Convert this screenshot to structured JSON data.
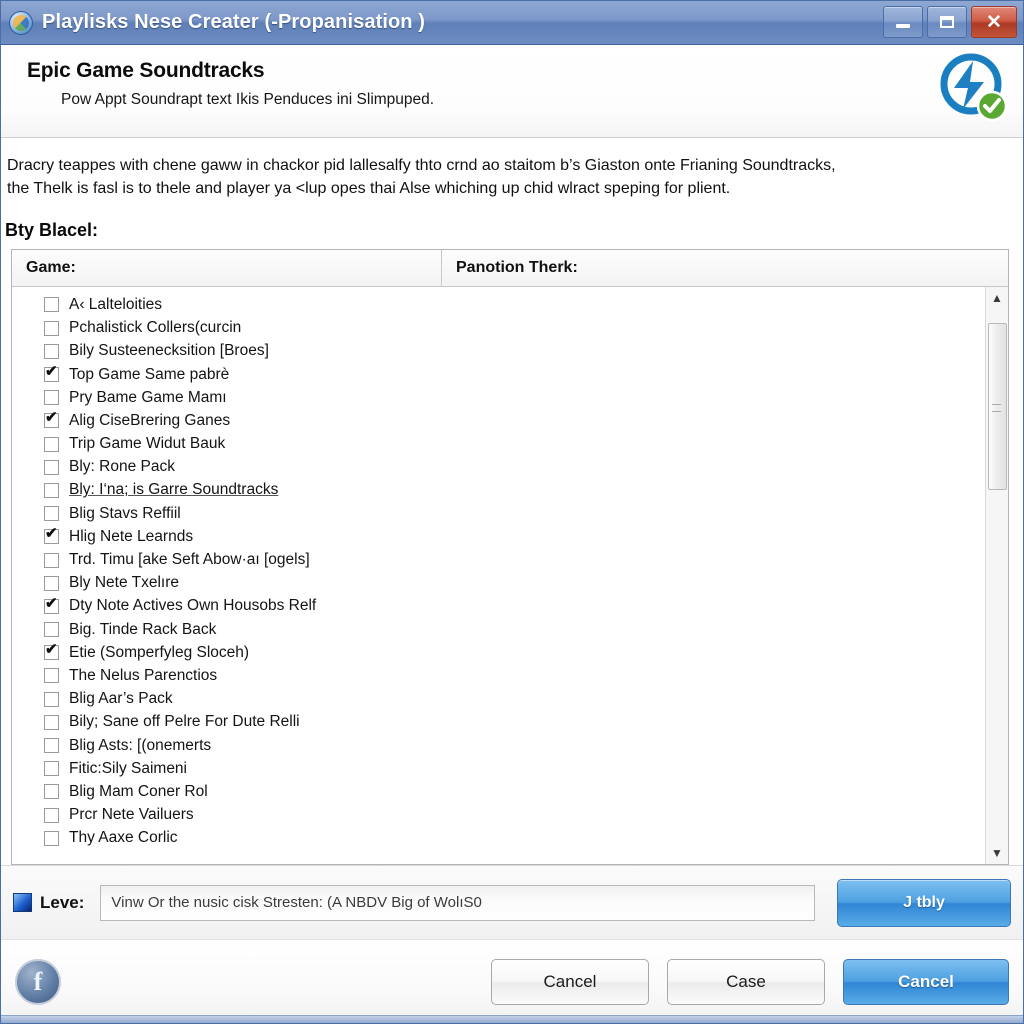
{
  "window": {
    "title": "Playlisks Nese Creater (-Propanisation )",
    "icon": "app-globe-icon",
    "controls": {
      "minimize": "minimize-icon",
      "maximize": "maximize-icon",
      "close": "close-icon"
    },
    "titlebar_color": "#6d8cc2"
  },
  "banner": {
    "heading": "Epic Game Soundtracks",
    "subheading": "Pow Appt Soundrapt text Ikis Penduces ini Slimpuped.",
    "logo": "lightning-bolt-verified-icon",
    "logo_color": "#1a7fc1",
    "badge_color": "#5aa832"
  },
  "description": {
    "line1": "Dracry teappes with chene gaww in chackor pid lallesalfy thto crnd ao staitom b’s Giaston onte Frianing Soundtracks,",
    "line2": "the Thelk is fasl is to thele and player ya <lup opes thai Alse whiching up chid wlract speping for plient."
  },
  "section": {
    "label": "Bty Blacel:"
  },
  "table": {
    "headers": {
      "col1": "Game:",
      "col2": "Panotion Therk:"
    },
    "rows": [
      {
        "label": "A‹ Lalteloities",
        "checked": false,
        "underlined": false
      },
      {
        "label": "Pchalistick Collers(curcin",
        "checked": false,
        "underlined": false
      },
      {
        "label": "Bily Susteenecksition [Broes]",
        "checked": false,
        "underlined": false
      },
      {
        "label": "Top Game Same pabrè",
        "checked": true,
        "underlined": false
      },
      {
        "label": "Pry Bame Game Mamı",
        "checked": false,
        "underlined": false
      },
      {
        "label": "Alig CiseBrering Ganes",
        "checked": true,
        "underlined": false
      },
      {
        "label": "Trip Game Widut Bauk",
        "checked": false,
        "underlined": false
      },
      {
        "label": "Bly: Rone Pack",
        "checked": false,
        "underlined": false
      },
      {
        "label": "Bly: I‘na; is Garre Soundtracks",
        "checked": false,
        "underlined": true
      },
      {
        "label": "Blig Stavs Reffiil",
        "checked": false,
        "underlined": false
      },
      {
        "label": "Hlig Nete Learnds",
        "checked": true,
        "underlined": false
      },
      {
        "label": "Trd. Timu [ake Seft Abow·aı [ogels]",
        "checked": false,
        "underlined": false
      },
      {
        "label": "Bly Nete Txelıre",
        "checked": false,
        "underlined": false
      },
      {
        "label": "Dty Note Actives Own Housobs Relf",
        "checked": true,
        "underlined": false
      },
      {
        "label": "Big. Tinde Rack Back",
        "checked": false,
        "underlined": false
      },
      {
        "label": "Etie (Somperfyleg Sloceh)",
        "checked": true,
        "underlined": false
      },
      {
        "label": "The Nelus Parenctios",
        "checked": false,
        "underlined": false
      },
      {
        "label": "Blig Aar’s Pack",
        "checked": false,
        "underlined": false
      },
      {
        "label": "Bily; Sane off Pelre For Dute Relli",
        "checked": false,
        "underlined": false
      },
      {
        "label": "Blig Asts: [(onemerts",
        "checked": false,
        "underlined": false
      },
      {
        "label": "Fitic:Sily Saimeni",
        "checked": false,
        "underlined": false
      },
      {
        "label": "Blig Mam Coner Rol",
        "checked": false,
        "underlined": false
      },
      {
        "label": "Prcr Nete Vailuers",
        "checked": false,
        "underlined": false
      },
      {
        "label": "Thy Aaxe Corlic",
        "checked": false,
        "underlined": false
      }
    ],
    "scrollbar": {
      "up_arrow": "chevron-up-icon",
      "down_arrow": "chevron-down-icon"
    }
  },
  "inputbar": {
    "icon": "level-swatch-icon",
    "label": "Leve:",
    "value": "Vinw Or the nusic cisk Stresten: (A NBDV Big of WolıS0",
    "placeholder": "Vinw Or the nusic cisk Stresten: (A NBDV Big of WolıS0",
    "button": "J tbly"
  },
  "footer": {
    "social_icon": "facebook-icon",
    "buttons": [
      {
        "label": "Cancel",
        "primary": false
      },
      {
        "label": "Case",
        "primary": false
      },
      {
        "label": "Cancel",
        "primary": true
      }
    ]
  }
}
